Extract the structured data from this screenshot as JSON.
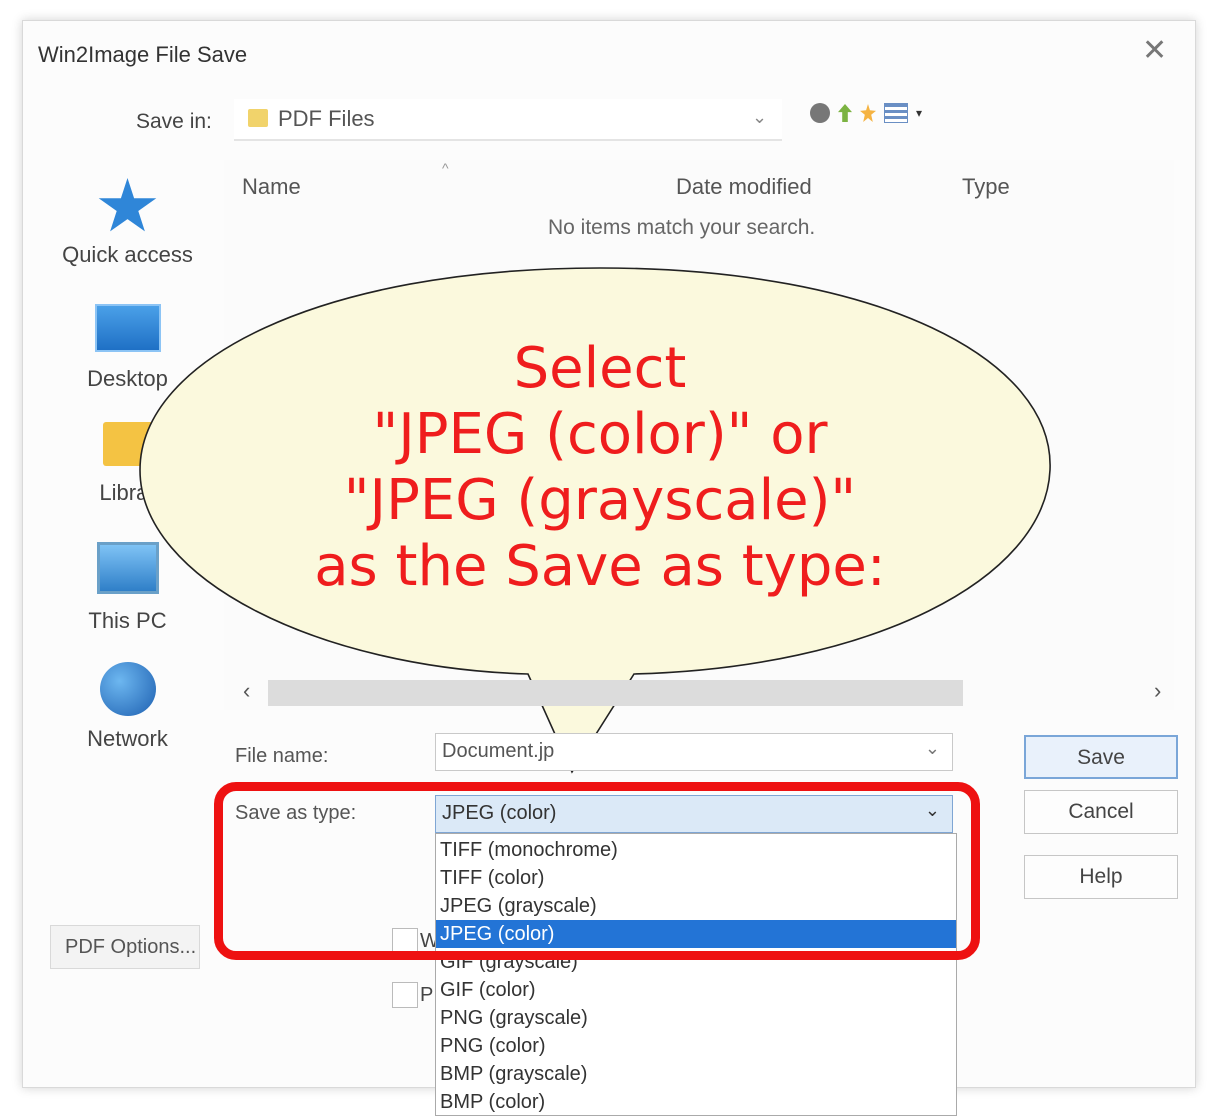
{
  "window": {
    "title": "Win2Image File Save",
    "close_glyph": "✕"
  },
  "toolbar": {
    "save_in_label": "Save in:",
    "current_folder": "PDF Files",
    "dropdown_glyph": "⌄",
    "icons": [
      "globe-icon",
      "up-folder-icon",
      "new-folder-icon",
      "view-menu-icon"
    ],
    "view_caret": "▾"
  },
  "places": [
    {
      "label": "Quick access",
      "icon": "star-icon"
    },
    {
      "label": "Desktop",
      "icon": "desktop-icon"
    },
    {
      "label": "Librar",
      "icon": "libraries-icon"
    },
    {
      "label": "This PC",
      "icon": "computer-icon"
    },
    {
      "label": "Network",
      "icon": "network-icon"
    }
  ],
  "file_list": {
    "columns": [
      "Name",
      "Date modified",
      "Type"
    ],
    "sort_glyph": "^",
    "empty_message": "No items match your search."
  },
  "scrollbar": {
    "left_glyph": "‹",
    "right_glyph": "›"
  },
  "file_name": {
    "label": "File name:",
    "value": "Document.jp",
    "chevron": "⌄"
  },
  "save_as_type": {
    "label": "Save as type:",
    "value": "JPEG (color)",
    "chevron": "⌄",
    "options": [
      "TIFF (monochrome)",
      "TIFF (color)",
      "JPEG (grayscale)",
      "JPEG (color)",
      "GIF (grayscale)",
      "GIF (color)",
      "PNG (grayscale)",
      "PNG (color)",
      "BMP (grayscale)",
      "BMP (color)"
    ],
    "selected_index": 3
  },
  "buttons": {
    "save": "Save",
    "cancel": "Cancel",
    "help": "Help",
    "pdf_options": "PDF Options..."
  },
  "checkboxes": [
    {
      "label": "W"
    },
    {
      "label": "P"
    }
  ],
  "callout": {
    "line1": "Select",
    "line2": "\"JPEG (color)\" or",
    "line3": "\"JPEG (grayscale)\"",
    "line4": "as the Save as type:"
  },
  "colors": {
    "callout_text": "#ef1d1d",
    "callout_fill": "#fbf9dd",
    "highlight": "#ee1111",
    "selection": "#2374d6"
  }
}
